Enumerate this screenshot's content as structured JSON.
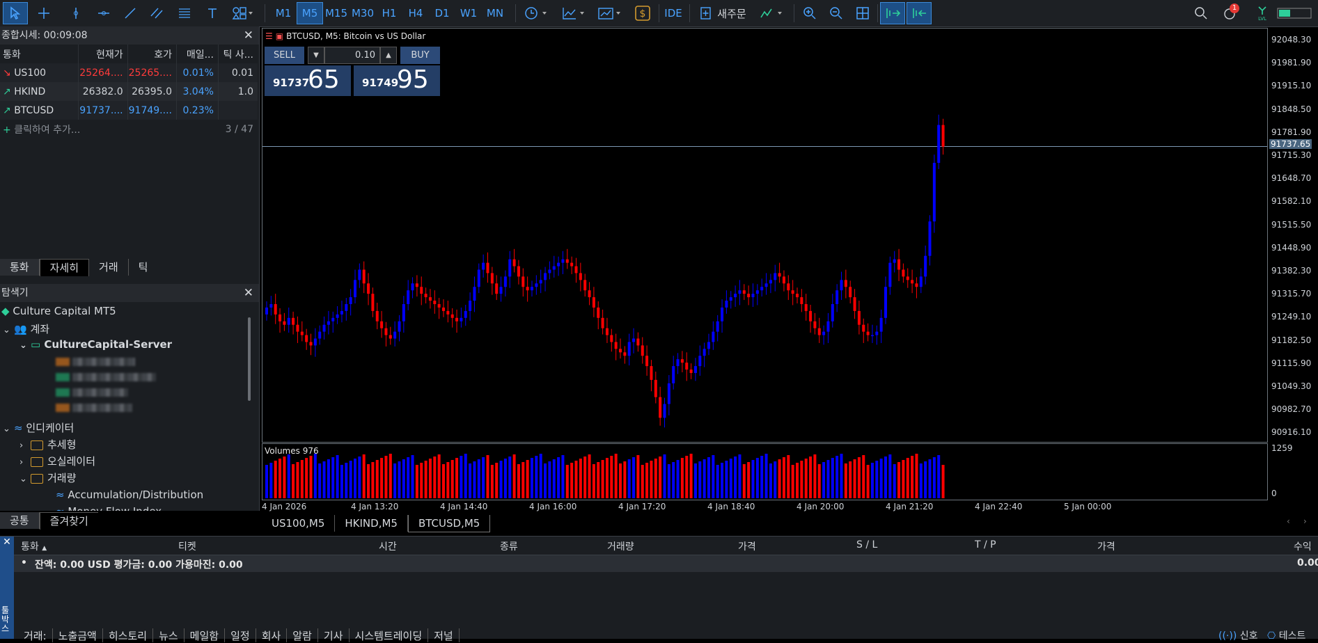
{
  "toolbar": {
    "timeframes": [
      "M1",
      "M5",
      "M15",
      "M30",
      "H1",
      "H4",
      "D1",
      "W1",
      "MN"
    ],
    "selected_timeframe": "M5",
    "ide_label": "IDE",
    "new_order_label": "새주문",
    "notification_count": "1"
  },
  "market_watch": {
    "title": "종합시세: 00:09:08",
    "columns": [
      "통화",
      "현재가",
      "호가",
      "매일...",
      "틱 사..."
    ],
    "rows": [
      {
        "symbol": "US100",
        "bid": "25264....",
        "ask": "25265....",
        "daily": "0.01%",
        "tick": "0.01",
        "dir": "down"
      },
      {
        "symbol": "HKIND",
        "bid": "26382.0",
        "ask": "26395.0",
        "daily": "3.04%",
        "tick": "1.0",
        "dir": "up"
      },
      {
        "symbol": "BTCUSD",
        "bid": "91737....",
        "ask": "91749....",
        "daily": "0.23%",
        "tick": "",
        "dir": "up"
      }
    ],
    "add_label": "클릭하여 추가...",
    "count": "3 / 47",
    "tabs": [
      "통화",
      "자세히",
      "거래",
      "틱"
    ]
  },
  "navigator": {
    "title": "탐색기",
    "root": "Culture Capital MT5",
    "accounts": "계좌",
    "server": "CultureCapital-Server",
    "indicators": "인디케이터",
    "folders": [
      "추세형",
      "오실레이터",
      "거래량"
    ],
    "items": [
      "Accumulation/Distribution",
      "Money Flow Index"
    ],
    "tabs": [
      "공통",
      "즐겨찾기"
    ]
  },
  "chart": {
    "title": "BTCUSD, M5:  Bitcoin vs US Dollar",
    "sell_label": "SELL",
    "buy_label": "BUY",
    "lot": "0.10",
    "sell_price_small": "91737",
    "sell_price_big": "65",
    "buy_price_small": "91749",
    "buy_price_big": "95",
    "current_price": "91737.65",
    "price_ticks": [
      "92048.30",
      "91981.90",
      "91915.10",
      "91848.50",
      "91781.90",
      "91715.30",
      "91648.70",
      "91582.10",
      "91515.50",
      "91448.90",
      "91382.30",
      "91315.70",
      "91249.10",
      "91182.50",
      "91115.90",
      "91049.30",
      "90982.70",
      "90916.10"
    ],
    "time_ticks": [
      "4 Jan 2026",
      "4 Jan 13:20",
      "4 Jan 14:40",
      "4 Jan 16:00",
      "4 Jan 17:20",
      "4 Jan 18:40",
      "4 Jan 20:00",
      "4 Jan 21:20",
      "4 Jan 22:40",
      "5 Jan 00:00"
    ],
    "volume_label": "Volumes 976",
    "volume_ticks": [
      "1259",
      "0"
    ],
    "tabs": [
      "US100,M5",
      "HKIND,M5",
      "BTCUSD,M5"
    ],
    "active_tab": "BTCUSD,M5",
    "up_color": "#0000ff",
    "down_color": "#ff0000"
  },
  "terminal": {
    "columns": [
      "통화",
      "티켓",
      "시간",
      "종류",
      "거래량",
      "가격",
      "S / L",
      "T / P",
      "가격",
      "수익"
    ],
    "balance_line": "잔액: 0.00 USD  평가금: 0.00  가용마진: 0.00",
    "profit": "0.00",
    "tabs": [
      "거래",
      "노출금액",
      "히스토리",
      "뉴스",
      "메일함",
      "일정",
      "회사",
      "알람",
      "기사",
      "시스템트레이딩",
      "저널"
    ],
    "side_label": "툴박스",
    "status_signal": "신호",
    "status_test": "테스트"
  },
  "chart_data": {
    "type": "candlestick",
    "symbol": "BTCUSD",
    "timeframe": "M5",
    "ylim": [
      90880,
      92080
    ],
    "close_profile": [
      91270,
      91280,
      91250,
      91230,
      91220,
      91240,
      91220,
      91200,
      91190,
      91170,
      91160,
      91180,
      91200,
      91220,
      91230,
      91240,
      91250,
      91260,
      91280,
      91300,
      91350,
      91380,
      91340,
      91310,
      91260,
      91230,
      91210,
      91190,
      91180,
      91200,
      91230,
      91280,
      91320,
      91340,
      91330,
      91310,
      91300,
      91290,
      91280,
      91270,
      91260,
      91250,
      91240,
      91230,
      91240,
      91260,
      91290,
      91330,
      91380,
      91400,
      91370,
      91340,
      91310,
      91330,
      91360,
      91410,
      91390,
      91360,
      91330,
      91320,
      91330,
      91340,
      91350,
      91370,
      91380,
      91390,
      91400,
      91410,
      91400,
      91390,
      91370,
      91350,
      91320,
      91300,
      91270,
      91240,
      91210,
      91190,
      91170,
      91150,
      91140,
      91130,
      91170,
      91180,
      91160,
      91130,
      91100,
      91060,
      91010,
      90950,
      90990,
      91050,
      91100,
      91120,
      91110,
      91090,
      91080,
      91100,
      91130,
      91150,
      91170,
      91200,
      91230,
      91270,
      91290,
      91300,
      91310,
      91320,
      91310,
      91300,
      91310,
      91320,
      91330,
      91340,
      91350,
      91370,
      91360,
      91340,
      91320,
      91310,
      91300,
      91280,
      91260,
      91230,
      91210,
      91190,
      91200,
      91230,
      91280,
      91320,
      91350,
      91330,
      91300,
      91260,
      91220,
      91200,
      91190,
      91190,
      91200,
      91240,
      91330,
      91400,
      91410,
      91380,
      91360,
      91350,
      91340,
      91330,
      91360,
      91420,
      91520,
      91690,
      91800,
      91737
    ]
  }
}
